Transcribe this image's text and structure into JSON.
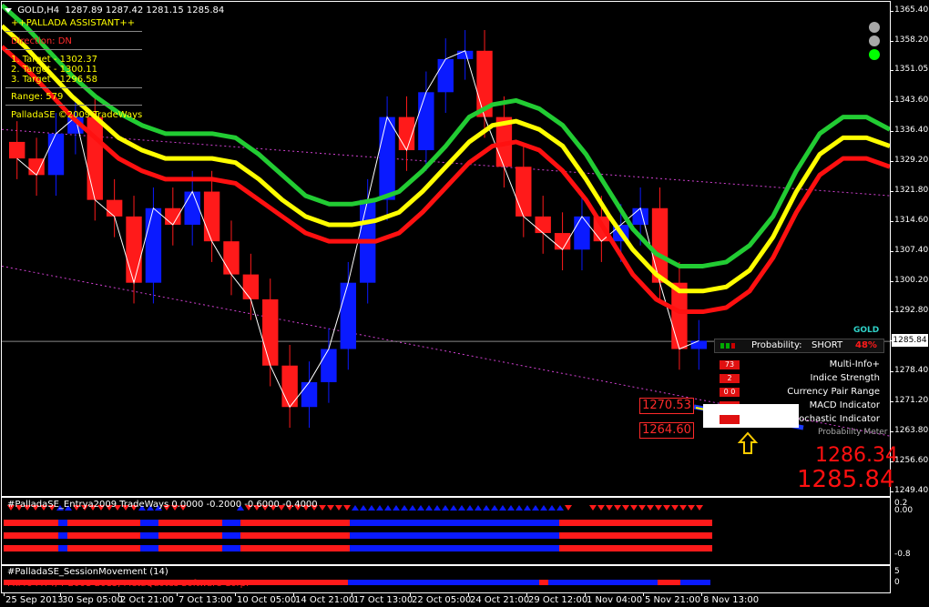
{
  "window": {
    "title": "GOLD,H4",
    "ohlc": "1287.89 1287.42 1281.15 1285.84"
  },
  "assistant": {
    "title": "++PALLADA ASSISTANT++",
    "direction": "Direction: DN",
    "targets": [
      "1. Target - 1302.37",
      "2. Target - 1300.11",
      "3. Target - 1296.58"
    ],
    "range": "Range: 579",
    "copyright": "PalladaSE ©2009 TradeWays"
  },
  "price_axis": {
    "ticks": [
      "1365.40",
      "1358.20",
      "1351.05",
      "1343.60",
      "1336.40",
      "1329.20",
      "1321.80",
      "1314.60",
      "1307.40",
      "1300.20",
      "1292.80",
      "1285.84",
      "1278.40",
      "1271.20",
      "1263.80",
      "1256.60",
      "1249.40"
    ],
    "current": "1285.84"
  },
  "levels": {
    "upper": "1270.53",
    "lower": "1264.60"
  },
  "prices": {
    "big1": "1286.34",
    "big2": "1285.84"
  },
  "info": {
    "symbol": "GOLD",
    "probability_label": "Probability:",
    "direction": "SHORT",
    "probability_value": "48%",
    "rows": [
      {
        "badge": "73",
        "label": "Multi-Info+"
      },
      {
        "badge": "2",
        "label": "Indice Strength"
      },
      {
        "badge": "0 0",
        "label": "Currency Pair Range"
      },
      {
        "badge": "",
        "label": "MACD Indicator"
      },
      {
        "badge": "",
        "label": "Stochastic Indicator"
      }
    ],
    "meter_label": "Probability Meter"
  },
  "status_dots": [
    "#a8a8a8",
    "#a8a8a8",
    "#00ff00"
  ],
  "sub1": {
    "label": "#PalladaSE_Entrya2009 TradeWays 0.0000 -0.2000 -0.6000 -0.4000",
    "axis": [
      "0.2",
      "0.00",
      "-0.8"
    ]
  },
  "sub2": {
    "label": "#PalladaSE_SessionMovement (14)",
    "copyright": "FxPro MT4, ? 2001-2013, MetaQuotes Software Corp.",
    "axis": [
      "5",
      "0"
    ]
  },
  "time_axis": [
    "25 Sep 2013",
    "30 Sep 05:00",
    "2 Oct 21:00",
    "7 Oct 13:00",
    "10 Oct 05:00",
    "14 Oct 21:00",
    "17 Oct 13:00",
    "22 Oct 05:00",
    "24 Oct 21:00",
    "29 Oct 12:00",
    "1 Nov 04:00",
    "5 Nov 21:00",
    "8 Nov 13:00"
  ],
  "colors": {
    "bull": "#0a1aff",
    "bear": "#ff1a1a",
    "band_green": "#22cc33",
    "band_yellow": "#ffff00",
    "band_red": "#ff1010",
    "bg": "#000000"
  },
  "chart_data": {
    "type": "candlestick",
    "ylim": [
      1249.4,
      1365.4
    ],
    "bands": {
      "green": [
        1367,
        1362,
        1356,
        1350,
        1345,
        1341,
        1338,
        1336,
        1336,
        1336,
        1335,
        1331,
        1326,
        1321,
        1319,
        1319,
        1320,
        1322,
        1327,
        1333,
        1340,
        1343,
        1344,
        1342,
        1338,
        1331,
        1322,
        1313,
        1307,
        1304,
        1304,
        1305,
        1309,
        1316,
        1327,
        1336,
        1340,
        1340,
        1337
      ],
      "yellow": [
        1362,
        1357,
        1351,
        1345,
        1340,
        1335,
        1332,
        1330,
        1330,
        1330,
        1329,
        1325,
        1320,
        1316,
        1314,
        1314,
        1315,
        1317,
        1322,
        1328,
        1334,
        1338,
        1339,
        1337,
        1333,
        1325,
        1316,
        1308,
        1302,
        1298,
        1298,
        1299,
        1303,
        1311,
        1322,
        1331,
        1335,
        1335,
        1333
      ],
      "red": [
        1357,
        1352,
        1346,
        1340,
        1335,
        1330,
        1327,
        1325,
        1325,
        1325,
        1324,
        1320,
        1316,
        1312,
        1310,
        1310,
        1310,
        1312,
        1317,
        1323,
        1329,
        1333,
        1334,
        1332,
        1327,
        1320,
        1311,
        1302,
        1296,
        1293,
        1293,
        1294,
        1298,
        1306,
        1317,
        1326,
        1330,
        1330,
        1328
      ]
    },
    "close": [
      1330,
      1326,
      1336,
      1340,
      1320,
      1316,
      1300,
      1318,
      1314,
      1322,
      1310,
      1302,
      1296,
      1280,
      1270,
      1276,
      1284,
      1300,
      1320,
      1340,
      1332,
      1346,
      1354,
      1356,
      1340,
      1328,
      1316,
      1312,
      1308,
      1316,
      1310,
      1314,
      1318,
      1300,
      1284,
      1286
    ],
    "upper_trend": [
      1337,
      1321
    ],
    "lower_trend": [
      1304,
      1263
    ]
  }
}
